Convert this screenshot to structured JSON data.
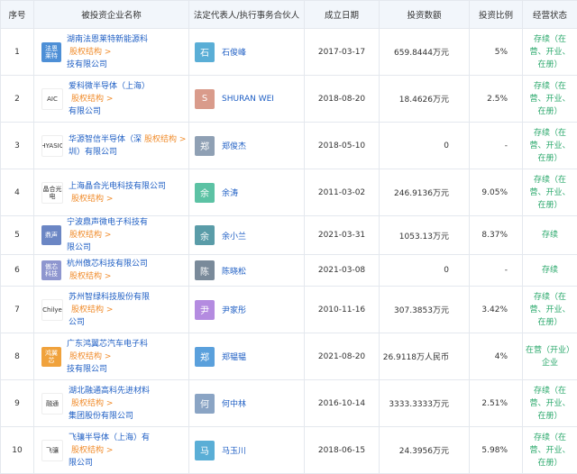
{
  "headers": [
    "序号",
    "被投资企业名称",
    "法定代表人/执行事务合伙人",
    "成立日期",
    "投资数额",
    "投资比例",
    "经营状态"
  ],
  "equity_label": "股权结构 >",
  "rows": [
    {
      "idx": "1",
      "logo_text": "法恩\n莱特",
      "logo_color": "#4d8fd6",
      "company_line1": "湖南法恩莱特新能源科",
      "company_line2": "技有限公司",
      "avatar_char": "石",
      "avatar_color": "#5aaed6",
      "rep": "石俊峰",
      "date": "2017-03-17",
      "amount": "659.8444万元",
      "ratio": "5%",
      "status_line1": "存续（在",
      "status_line2": "营、开业、",
      "status_line3": "在册）"
    },
    {
      "idx": "2",
      "logo_text": "AIC",
      "logo_color": "#ffffff",
      "company_line1": "爱科微半导体（上海）",
      "company_line2": "有限公司",
      "avatar_char": "S",
      "avatar_color": "#d99b8b",
      "rep": "SHURAN WEI",
      "date": "2018-08-20",
      "amount": "18.4626万元",
      "ratio": "2.5%",
      "status_line1": "存续（在",
      "status_line2": "营、开业、",
      "status_line3": "在册）"
    },
    {
      "idx": "3",
      "logo_text": "HYASIC",
      "logo_color": "#ffffff",
      "company_line1": "华源智信半导体（深",
      "company_line2": "圳）有限公司",
      "avatar_char": "郑",
      "avatar_color": "#8fa0b4",
      "rep": "郑俊杰",
      "date": "2018-05-10",
      "amount": "0",
      "ratio": "-",
      "status_line1": "存续（在",
      "status_line2": "营、开业、",
      "status_line3": "在册）"
    },
    {
      "idx": "4",
      "logo_text": "晶合光电",
      "logo_color": "#ffffff",
      "company_line1": "上海晶合光电科技有限公司",
      "company_line2": "",
      "avatar_char": "余",
      "avatar_color": "#5cc2a4",
      "rep": "余涛",
      "date": "2011-03-02",
      "amount": "246.9136万元",
      "ratio": "9.05%",
      "status_line1": "存续（在",
      "status_line2": "营、开业、",
      "status_line3": "在册）"
    },
    {
      "idx": "5",
      "logo_text": "鼎声",
      "logo_color": "#6b86c4",
      "company_line1": "宁波鼎声微电子科技有",
      "company_line2": "限公司",
      "avatar_char": "余",
      "avatar_color": "#5a9ca8",
      "rep": "余小兰",
      "date": "2021-03-31",
      "amount": "1053.13万元",
      "ratio": "8.37%",
      "status_line1": "存续",
      "status_line2": "",
      "status_line3": ""
    },
    {
      "idx": "6",
      "logo_text": "傲芯\n科技",
      "logo_color": "#8e96cf",
      "company_line1": "杭州傲芯科技有限公司",
      "company_line2": "",
      "avatar_char": "陈",
      "avatar_color": "#7a8a9a",
      "rep": "陈晓松",
      "date": "2021-03-08",
      "amount": "0",
      "ratio": "-",
      "status_line1": "存续",
      "status_line2": "",
      "status_line3": ""
    },
    {
      "idx": "7",
      "logo_text": "Chilye",
      "logo_color": "#ffffff",
      "company_line1": "苏州智绿科技股份有限",
      "company_line2": "公司",
      "avatar_char": "尹",
      "avatar_color": "#b48be0",
      "rep": "尹家彤",
      "date": "2010-11-16",
      "amount": "307.3853万元",
      "ratio": "3.42%",
      "status_line1": "存续（在",
      "status_line2": "营、开业、",
      "status_line3": "在册）"
    },
    {
      "idx": "8",
      "logo_text": "鸿翼\n芯",
      "logo_color": "#f0a23c",
      "company_line1": "广东鸿翼芯汽车电子科",
      "company_line2": "技有限公司",
      "avatar_char": "郑",
      "avatar_color": "#5aa0dc",
      "rep": "郑韫韫",
      "date": "2021-08-20",
      "amount": "26.9118万人民币",
      "ratio": "4%",
      "status_line1": "在营（开业）",
      "status_line2": "企业",
      "status_line3": ""
    },
    {
      "idx": "9",
      "logo_text": "融通",
      "logo_color": "#ffffff",
      "company_line1": "湖北融通高科先进材料",
      "company_line2": "集团股份有限公司",
      "avatar_char": "何",
      "avatar_color": "#8aa4c4",
      "rep": "何中林",
      "date": "2016-10-14",
      "amount": "3333.3333万元",
      "ratio": "2.51%",
      "status_line1": "存续（在",
      "status_line2": "营、开业、",
      "status_line3": "在册）"
    },
    {
      "idx": "10",
      "logo_text": "飞骧",
      "logo_color": "#ffffff",
      "company_line1": "飞骧半导体（上海）有",
      "company_line2": "限公司",
      "avatar_char": "马",
      "avatar_color": "#5aaed6",
      "rep": "马玉川",
      "date": "2018-06-15",
      "amount": "24.3956万元",
      "ratio": "5.98%",
      "status_line1": "存续（在",
      "status_line2": "营、开业、",
      "status_line3": "在册）"
    }
  ]
}
